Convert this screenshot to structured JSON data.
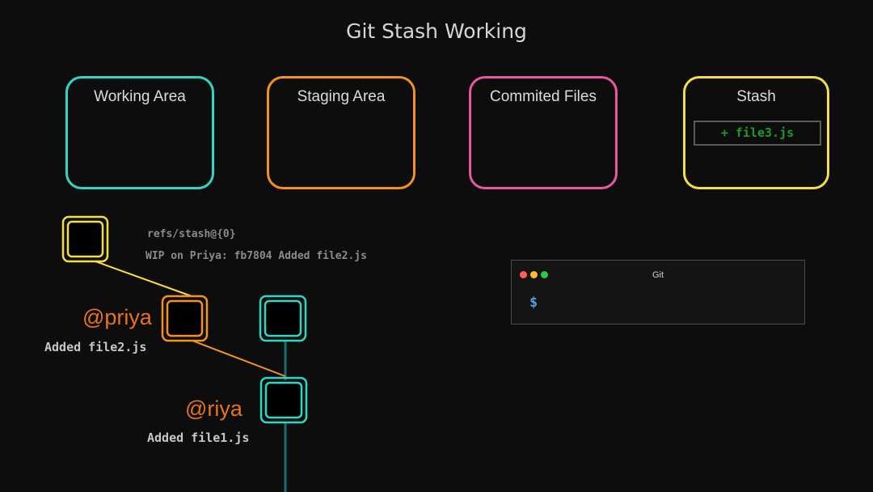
{
  "title": "Git Stash Working",
  "areas": {
    "working": {
      "label": "Working Area",
      "color": "#30d6c4"
    },
    "staging": {
      "label": "Staging Area",
      "color": "#f5921e"
    },
    "committed": {
      "label": "Commited Files",
      "color": "#e8589c"
    },
    "stash": {
      "label": "Stash",
      "color": "#f3df45",
      "entry": "+ file3.js"
    }
  },
  "stash_ref": {
    "ref": "refs/stash@{0}",
    "message": "WIP on Priya: fb7804 Added file2.js"
  },
  "commits": {
    "priya": {
      "branch": "@priya",
      "message": "Added file2.js"
    },
    "riya": {
      "branch": "@riya",
      "message": "Added file1.js"
    }
  },
  "terminal": {
    "title": "Git",
    "prompt": "$"
  },
  "colors": {
    "background": "#0e0d0e",
    "stash_node": "#f3df45",
    "priya_node": "#f5921e",
    "main_node": "#30d6c4",
    "main_line": "#1a6b6b",
    "branch_label": "#e8731f",
    "stash_entry_text": "#1e9a2c",
    "prompt": "#4f9ed8"
  }
}
